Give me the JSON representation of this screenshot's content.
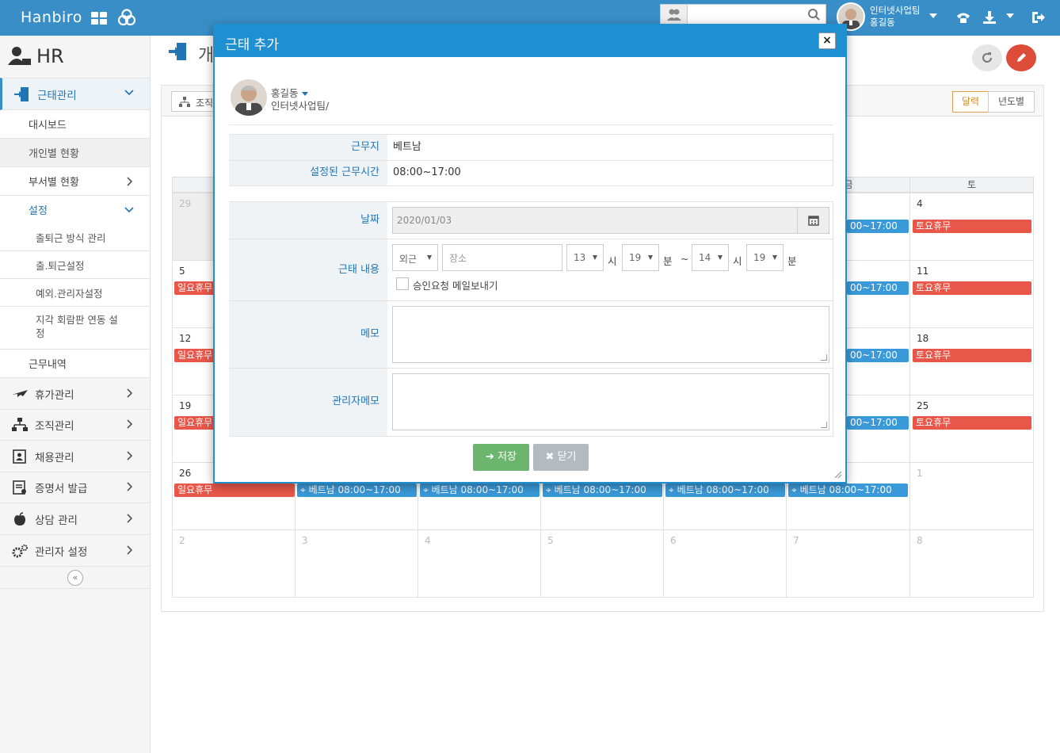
{
  "topbar": {
    "brand": "Hanbiro",
    "search_placeholder": "",
    "user_team": "인터넷사업팀",
    "user_name": "홍길동",
    "colors": {
      "bar": "#3a8ec7"
    }
  },
  "sidebar": {
    "module_title": "HR",
    "items": [
      {
        "label": "근태관리",
        "icon": "attendance-icon",
        "active": true
      },
      {
        "label": "대시보드"
      },
      {
        "label": "개인별 현황"
      },
      {
        "label": "부서별 현황"
      },
      {
        "label": "설정"
      },
      {
        "label": "출퇴근 방식 관리"
      },
      {
        "label": "출.퇴근설정"
      },
      {
        "label": "예외.관리자설정"
      },
      {
        "label": "지각 회람판 연동 설정"
      },
      {
        "label": "근무내역"
      },
      {
        "label": "휴가관리",
        "icon": "plane-icon"
      },
      {
        "label": "조직관리",
        "icon": "org-chart-icon"
      },
      {
        "label": "채용관리",
        "icon": "id-card-icon"
      },
      {
        "label": "증명서 발급",
        "icon": "certificate-icon"
      },
      {
        "label": "상담 관리",
        "icon": "apple-icon"
      },
      {
        "label": "관리자 설정",
        "icon": "gears-icon"
      }
    ],
    "collapse_glyph": "«"
  },
  "page": {
    "title_partial": "개",
    "org_button": "조직",
    "view_calendar": "달력",
    "view_yearly": "년도별"
  },
  "calendar": {
    "weekday_fri_partial": "금",
    "weekday_sat": "토",
    "sun_holiday": "일요휴무",
    "sat_holiday": "토요휴무",
    "shift_partial": "00~17:00",
    "shift_full": "베트남 08:00~17:00",
    "dates": {
      "r1_sun": "29",
      "r1_sat": "4",
      "r2_sun": "5",
      "r2_sat": "11",
      "r3_sun": "12",
      "r3_sat": "18",
      "r4_sun": "19",
      "r4_sat": "25",
      "r5_sun": "26",
      "r5_sat": "1",
      "r6": [
        "2",
        "3",
        "4",
        "5",
        "6",
        "7",
        "8"
      ]
    }
  },
  "modal": {
    "title": "근태 추가",
    "user_name": "홍길동",
    "user_dept": "인터넷사업팀/",
    "rows": {
      "workplace_label": "근무지",
      "workplace_value": "베트남",
      "hours_label": "설정된 근무시간",
      "hours_value": "08:00~17:00",
      "date_label": "날짜",
      "date_value": "2020/01/03",
      "content_label": "근태 내용",
      "type_value": "외근",
      "place_placeholder": "장소",
      "start_hour": "13",
      "start_min": "19",
      "end_hour": "14",
      "end_min": "19",
      "hour_unit": "시",
      "min_unit": "분",
      "tilde": "~",
      "mail_label": "승인요청 메일보내기",
      "memo_label": "메모",
      "admin_memo_label": "관리자메모"
    },
    "save_label": "저장",
    "close_label": "닫기",
    "close_x": "×"
  }
}
